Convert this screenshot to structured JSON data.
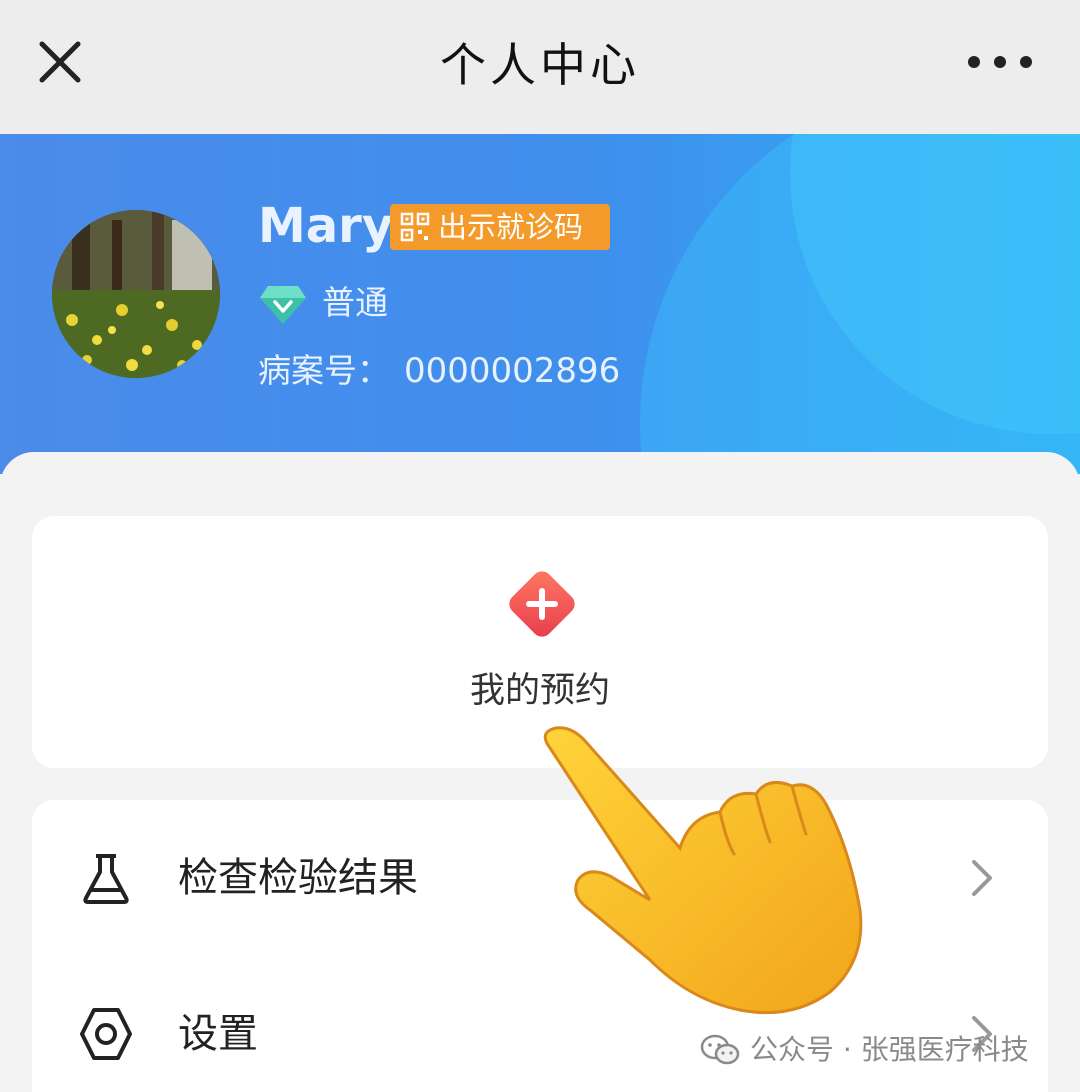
{
  "header": {
    "title": "个人中心"
  },
  "profile": {
    "name": "Mary",
    "qr_button_label": "出示就诊码",
    "level_label": "普通",
    "record_label": "病案号：",
    "record_number": "0000002896"
  },
  "appointment": {
    "label": "我的预约"
  },
  "menu": {
    "items": [
      {
        "label": "检查检验结果",
        "icon": "flask-icon"
      },
      {
        "label": "设置",
        "icon": "hexagon-settings-icon"
      }
    ]
  },
  "watermark": {
    "text": "公众号 · 张强医疗科技"
  },
  "colors": {
    "header_blue": "#4b8bea",
    "header_cyan": "#2fb0f5",
    "qr_badge_orange": "#f39a2b",
    "appointment_red": "#f0554f"
  }
}
